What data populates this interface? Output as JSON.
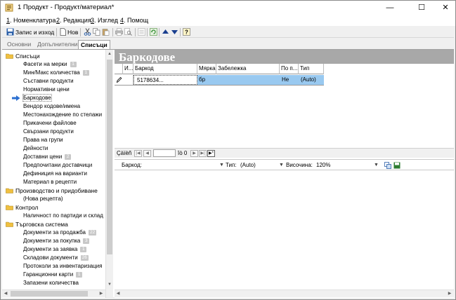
{
  "window": {
    "title": "1 Продукт - Продукт/материал*",
    "minimize": "—",
    "maximize": "☐",
    "close": "✕"
  },
  "menu": {
    "items": [
      {
        "key": "1",
        "label": "Номенклатура"
      },
      {
        "key": "2",
        "label": "Редакция"
      },
      {
        "key": "3",
        "label": "Изглед"
      },
      {
        "key": "4",
        "label": "Помощ"
      }
    ]
  },
  "toolbar": {
    "save_close_label": "Запис и изход",
    "new_label": "Нов",
    "icons": [
      "save-icon",
      "new-doc-icon",
      "cut-icon",
      "copy-icon",
      "paste-icon",
      "print-icon",
      "print-preview-icon",
      "filter-icon",
      "refresh-icon",
      "arrow-up-icon",
      "arrow-down-icon",
      "help-icon"
    ]
  },
  "tabs": {
    "items": [
      "Основни",
      "Допълнителни",
      "Списъци"
    ],
    "active": "Списъци"
  },
  "tree": {
    "items": [
      {
        "label": "Списъци",
        "type": "folder"
      },
      {
        "label": "Фасети на мерки",
        "badge": "1"
      },
      {
        "label": "Мин/Макс количества",
        "badge": "1"
      },
      {
        "label": "Съставни продукти"
      },
      {
        "label": "Нормативни цени"
      },
      {
        "label": "Баркодове",
        "selected": true
      },
      {
        "label": "Вендор кодове/имена"
      },
      {
        "label": "Местонахождение по стелажи"
      },
      {
        "label": "Прикачени файлове"
      },
      {
        "label": "Свързани продукти"
      },
      {
        "label": "Права на групи"
      },
      {
        "label": "Дейности"
      },
      {
        "label": "Доставни цени",
        "badge": "2"
      },
      {
        "label": "Предпочитани доставчици"
      },
      {
        "label": "Дефиниция на варианти"
      },
      {
        "label": "Материал в рецепти"
      },
      {
        "label": "Производство и придобиване",
        "type": "folder"
      },
      {
        "label": "(Нова рецепта)"
      },
      {
        "label": "Контрол",
        "type": "folder"
      },
      {
        "label": "Наличност по партиди и склад"
      },
      {
        "label": "Търговска система",
        "type": "folder"
      },
      {
        "label": "Документи за продажба",
        "badge": "22"
      },
      {
        "label": "Документи за покупка",
        "badge": "3"
      },
      {
        "label": "Документи за заявка",
        "badge": "1"
      },
      {
        "label": "Складови документи",
        "badge": "26"
      },
      {
        "label": "Протоколи за инвентаризация"
      },
      {
        "label": "Гаранционни карти",
        "badge": "1"
      },
      {
        "label": "Запазени количества"
      }
    ]
  },
  "panel": {
    "title": "Баркодове",
    "columns": [
      "И...",
      "Баркод",
      "Мярка",
      "Забележка",
      "По п...",
      "Тип"
    ],
    "rows": [
      {
        "barcode": "5178634...",
        "unit": "бр",
        "note": "",
        "default": "Не",
        "type": "(Auto)"
      }
    ],
    "nav": {
      "record_label": "Çàïèñ",
      "of_label": "îò 0",
      "current": ""
    }
  },
  "barcode_bar": {
    "barcode_label": "Баркод:",
    "barcode_value": "",
    "type_label": "Тип:",
    "type_value": "(Auto)",
    "height_label": "Височина:",
    "height_value": "120%"
  }
}
